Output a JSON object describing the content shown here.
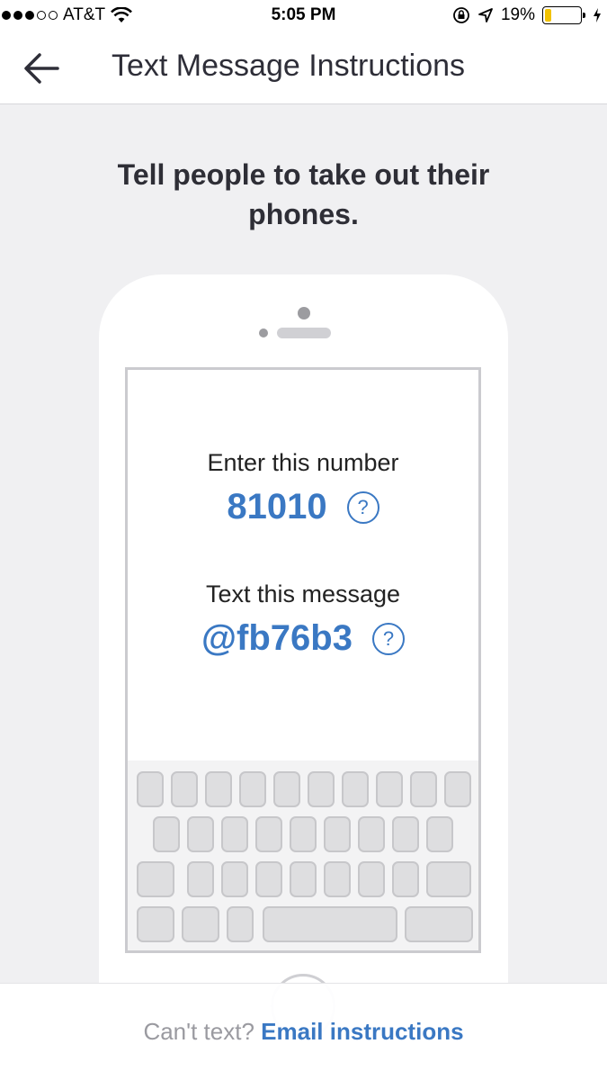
{
  "status_bar": {
    "carrier": "AT&T",
    "time": "5:05 PM",
    "battery_percent": "19%",
    "battery_level": 0.19,
    "signal_bars_filled": 3,
    "signal_bars_total": 5,
    "battery_color": "#f2c200"
  },
  "nav": {
    "title": "Text Message Instructions",
    "back_icon": "arrow-left-icon"
  },
  "headline": "Tell people to take out their phones.",
  "instructions": {
    "number_label": "Enter this number",
    "number_value": "81010",
    "message_label": "Text this message",
    "message_value": "@fb76b3",
    "help_glyph": "?"
  },
  "footer": {
    "prefix": "Can't text?",
    "link_label": "Email instructions"
  },
  "colors": {
    "accent": "#3a78c3",
    "background": "#f0f0f2"
  }
}
